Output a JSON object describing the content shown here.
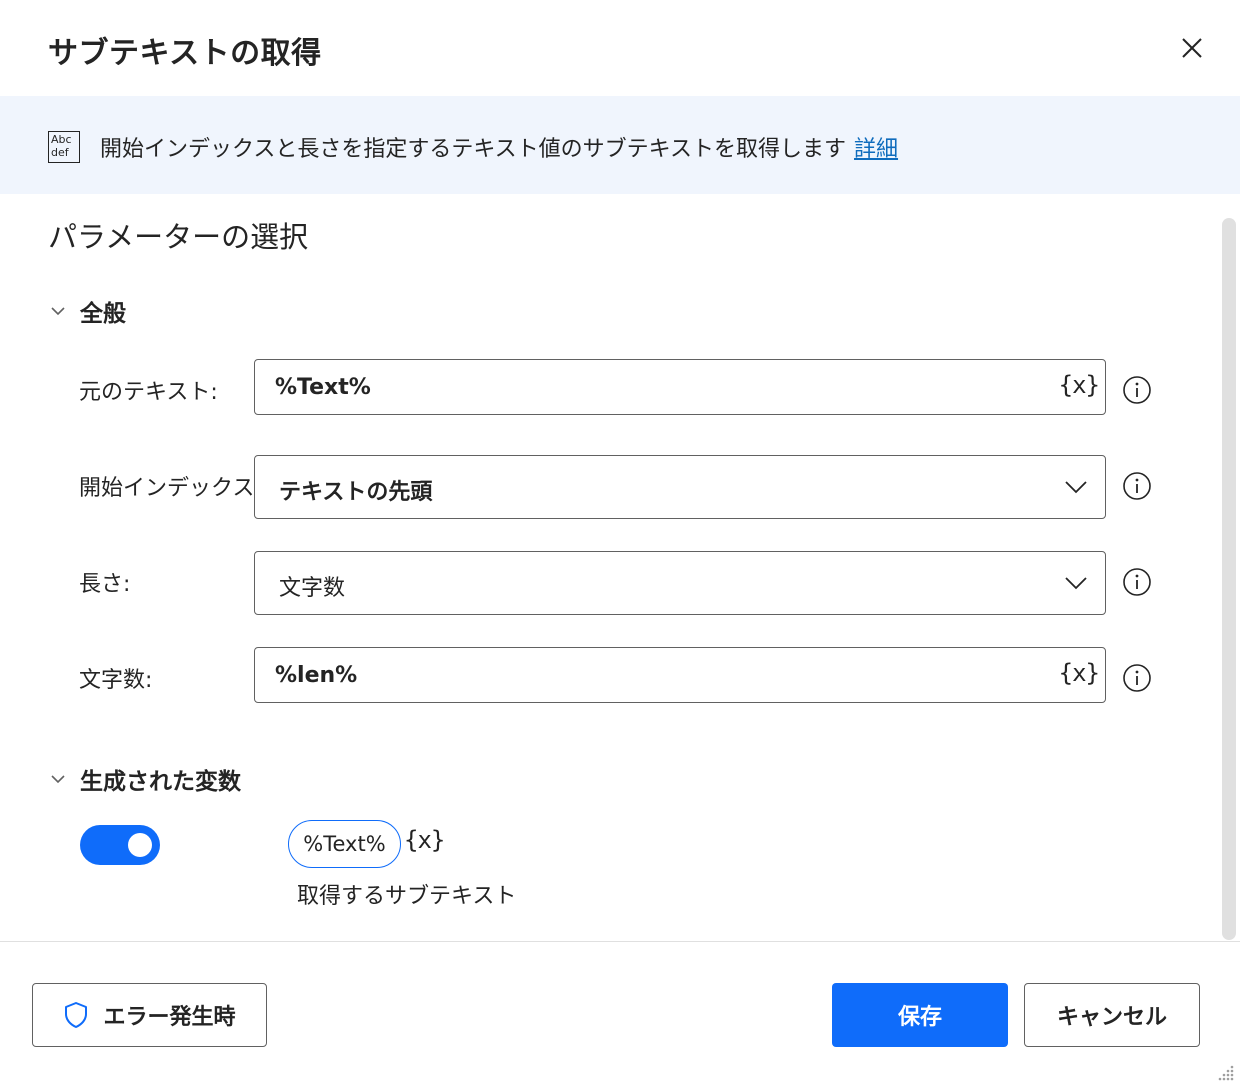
{
  "dialog": {
    "title": "サブテキストの取得",
    "close_icon": "close-icon"
  },
  "banner": {
    "icon": "text-abc-def-icon",
    "icon_text_top": "Abc",
    "icon_text_bottom": "def",
    "description": "開始インデックスと長さを指定するテキスト値のサブテキストを取得します",
    "link": "詳細"
  },
  "params": {
    "section_title": "パラメーターの選択",
    "general_group": "全般",
    "rows": [
      {
        "label": "元のテキスト:",
        "value": "%Text%",
        "kind": "text-with-variable"
      },
      {
        "label": "開始インデックス:",
        "value": "テキストの先頭",
        "kind": "dropdown"
      },
      {
        "label": "長さ:",
        "value": "文字数",
        "kind": "dropdown"
      },
      {
        "label": "文字数:",
        "value": "%len%",
        "kind": "text-with-variable"
      }
    ],
    "variable_button": "{x}"
  },
  "generated": {
    "group_title": "生成された変数",
    "toggle_on": true,
    "variable_name": "%Text%",
    "variable_button": "{x}",
    "variable_description": "取得するサブテキスト"
  },
  "footer": {
    "on_error_label": "エラー発生時",
    "on_error_icon": "shield-icon",
    "save_label": "保存",
    "cancel_label": "キャンセル"
  },
  "colors": {
    "accent": "#0f6cfa",
    "banner_bg": "#f0f5fd",
    "link": "#0f6cbd",
    "text": "#242424"
  }
}
